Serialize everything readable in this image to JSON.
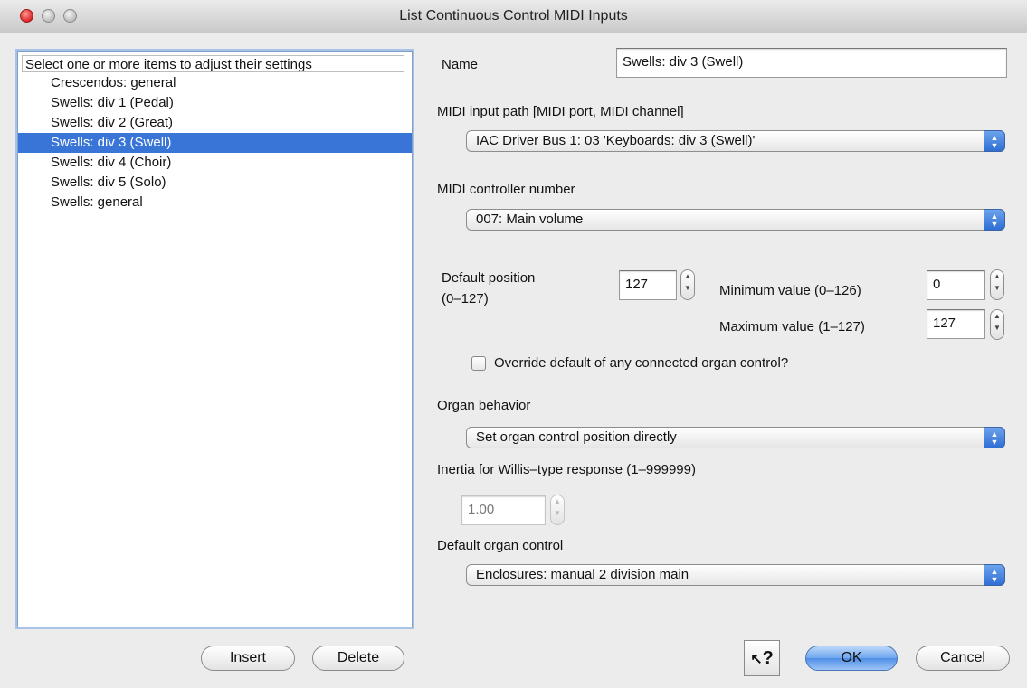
{
  "window": {
    "title": "List Continuous Control MIDI Inputs"
  },
  "list": {
    "header": "Select one or more items to adjust their settings",
    "items": [
      "Crescendos: general",
      "Swells: div 1 (Pedal)",
      "Swells: div 2 (Great)",
      "Swells: div 3 (Swell)",
      "Swells: div 4 (Choir)",
      "Swells: div 5 (Solo)",
      "Swells: general"
    ],
    "selected_index": 3
  },
  "form": {
    "name_label": "Name",
    "name_value": "Swells: div 3 (Swell)",
    "midi_path_label": "MIDI input path [MIDI port, MIDI channel]",
    "midi_path_value": "IAC Driver Bus 1: 03 'Keyboards: div 3 (Swell)'",
    "controller_label": "MIDI controller number",
    "controller_value": "007: Main volume",
    "default_position_label_1": "Default position",
    "default_position_label_2": "(0–127)",
    "default_position_value": "127",
    "minimum_label": "Minimum value (0–126)",
    "minimum_value": "0",
    "maximum_label": "Maximum value (1–127)",
    "maximum_value": "127",
    "override_label": "Override default of any connected organ control?",
    "override_checked": false,
    "behavior_label": "Organ behavior",
    "behavior_value": "Set organ control position directly",
    "inertia_label": "Inertia for Willis–type response (1–999999)",
    "inertia_value": "1.00",
    "default_control_label": "Default organ control",
    "default_control_value": "Enclosures: manual 2 division main"
  },
  "buttons": {
    "insert": "Insert",
    "delete": "Delete",
    "help": "?",
    "ok": "OK",
    "cancel": "Cancel"
  },
  "colors": {
    "selection": "#3875d7",
    "default_button": "#6ea6ee"
  }
}
